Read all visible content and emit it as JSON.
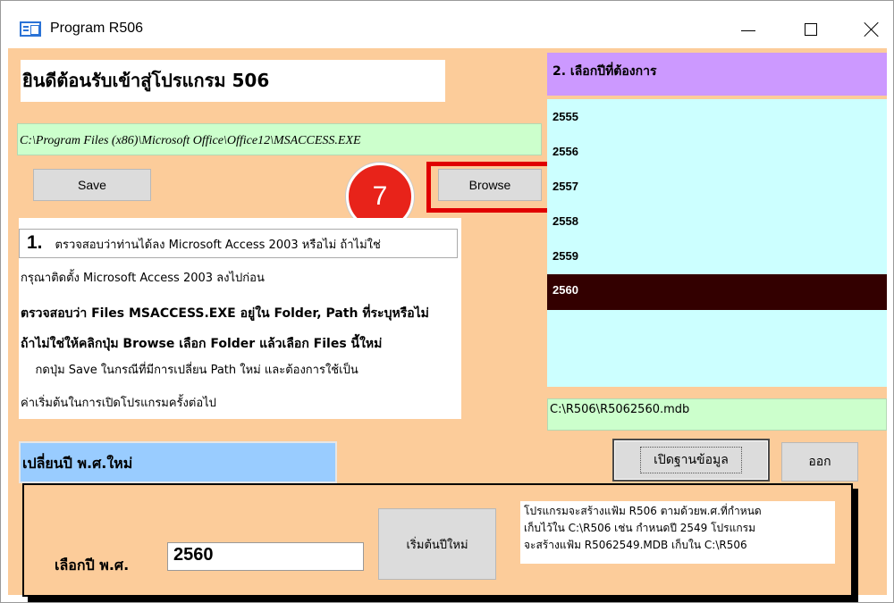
{
  "window": {
    "title": "Program R506"
  },
  "welcome": {
    "text": "ยินดีต้อนรับเข้าสู่โปรแกรม 506"
  },
  "access_path": {
    "value": "C:\\Program Files (x86)\\Microsoft Office\\Office12\\MSACCESS.EXE"
  },
  "buttons": {
    "save": "Save",
    "browse": "Browse",
    "open_db": "เปิดฐานข้อมูล",
    "exit": "ออก",
    "start_new_year": "เริ่มต้นปีใหม่"
  },
  "step_badge": {
    "number": "7",
    "color": "#e8231a"
  },
  "instructions": {
    "number": "1.",
    "line1": "ตรวจสอบว่าท่านได้ลง Microsoft Access 2003 หรือไม่ ถ้าไม่ใช่",
    "line2": "กรุณาติดตั้ง Microsoft Access 2003 ลงไปก่อน",
    "line3": "ตรวจสอบว่า Files  MSACCESS.EXE อยู่ใน Folder, Path ที่ระบุหรือไม่",
    "line4": "ถ้าไม่ใช่ให้คลิกปุ่ม  Browse เลือก Folder แล้วเลือก Files นี้ใหม่",
    "line5": "    กดปุ่ม Save ในกรณีที่มีการเปลี่ยน Path ใหม่ และต้องการใช้เป็น",
    "line6": "ค่าเริ่มต้นในการเปิดโปรแกรมครั้งต่อไป"
  },
  "year_list": {
    "header": "2. เลือกปีที่ต้องการ",
    "items": [
      "2555",
      "2556",
      "2557",
      "2558",
      "2559",
      "2560"
    ],
    "selected": "2560"
  },
  "mdb_path": {
    "value": "C:\\R506\\R5062560.mdb"
  },
  "change_year": {
    "title": "เปลี่ยนปี พ.ศ.ใหม่",
    "label": "เลือกปี พ.ศ.",
    "value": "2560"
  },
  "note": {
    "line1": "โปรแกรมจะสร้างแฟ้ม R506 ตามด้วยพ.ศ.ที่กำหนด",
    "line2": "เก็บไว้ใน C:\\R506 เช่น กำหนดปี 2549 โปรแกรม",
    "line3": "จะสร้างแฟ้ม R5062549.MDB  เก็บใน C:\\R506"
  }
}
